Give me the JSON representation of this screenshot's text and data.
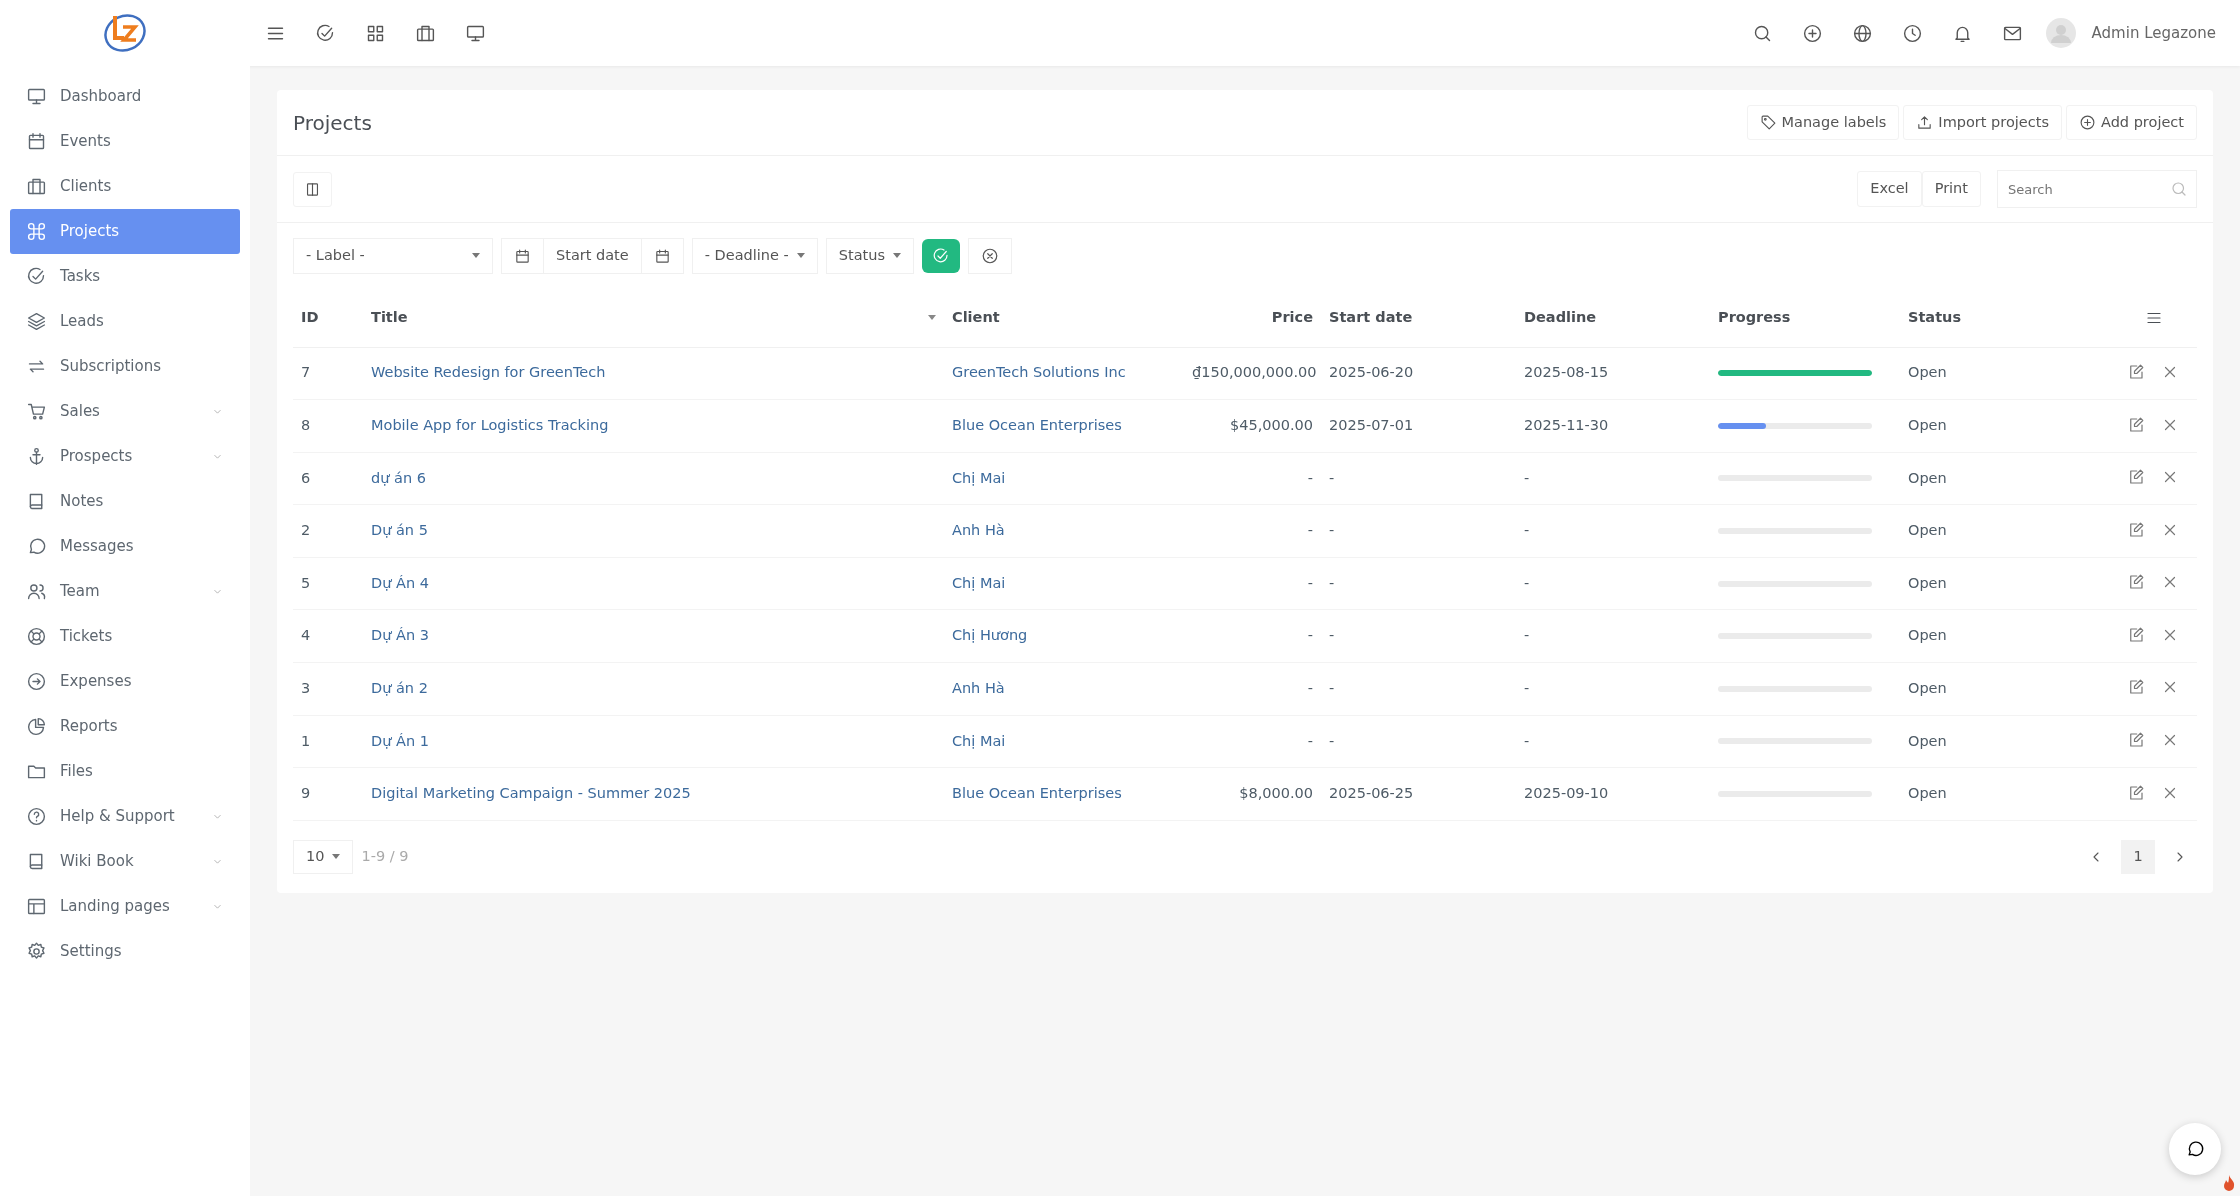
{
  "user": {
    "name": "Admin Legazone"
  },
  "sidebar": {
    "items": [
      {
        "label": "Dashboard",
        "selected": false,
        "has_submenu": false
      },
      {
        "label": "Events",
        "selected": false,
        "has_submenu": false
      },
      {
        "label": "Clients",
        "selected": false,
        "has_submenu": false
      },
      {
        "label": "Projects",
        "selected": true,
        "has_submenu": false
      },
      {
        "label": "Tasks",
        "selected": false,
        "has_submenu": false
      },
      {
        "label": "Leads",
        "selected": false,
        "has_submenu": false
      },
      {
        "label": "Subscriptions",
        "selected": false,
        "has_submenu": false
      },
      {
        "label": "Sales",
        "selected": false,
        "has_submenu": true
      },
      {
        "label": "Prospects",
        "selected": false,
        "has_submenu": true
      },
      {
        "label": "Notes",
        "selected": false,
        "has_submenu": false
      },
      {
        "label": "Messages",
        "selected": false,
        "has_submenu": false
      },
      {
        "label": "Team",
        "selected": false,
        "has_submenu": true
      },
      {
        "label": "Tickets",
        "selected": false,
        "has_submenu": false
      },
      {
        "label": "Expenses",
        "selected": false,
        "has_submenu": false
      },
      {
        "label": "Reports",
        "selected": false,
        "has_submenu": false
      },
      {
        "label": "Files",
        "selected": false,
        "has_submenu": false
      },
      {
        "label": "Help & Support",
        "selected": false,
        "has_submenu": true
      },
      {
        "label": "Wiki Book",
        "selected": false,
        "has_submenu": true
      },
      {
        "label": "Landing pages",
        "selected": false,
        "has_submenu": true
      },
      {
        "label": "Settings",
        "selected": false,
        "has_submenu": false
      }
    ]
  },
  "page": {
    "title": "Projects",
    "actions": [
      {
        "label": "Manage labels"
      },
      {
        "label": "Import projects"
      },
      {
        "label": "Add project"
      }
    ]
  },
  "toolbar": {
    "export_buttons": [
      "Excel",
      "Print"
    ],
    "search": {
      "placeholder": "Search"
    }
  },
  "filters": {
    "label_select": "- Label -",
    "start_date": "Start date",
    "deadline": "- Deadline -",
    "status": "Status"
  },
  "table": {
    "columns": [
      "ID",
      "Title",
      "Client",
      "Price",
      "Start date",
      "Deadline",
      "Progress",
      "Status"
    ],
    "rows": [
      {
        "id": "7",
        "title": "Website Redesign for GreenTech",
        "client": "GreenTech Solutions Inc",
        "price": "₫150,000,000.00",
        "start_date": "2025-06-20",
        "deadline": "2025-08-15",
        "progress": {
          "level": 1
        },
        "status": "Open"
      },
      {
        "id": "8",
        "title": "Mobile App for Logistics Tracking",
        "client": "Blue Ocean Enterprises",
        "price": "$45,000.00",
        "start_date": "2025-07-01",
        "deadline": "2025-11-30",
        "progress": {
          "level": 0.31
        },
        "status": "Open"
      },
      {
        "id": "6",
        "title": "dự án 6",
        "client": "Chị Mai",
        "price": "-",
        "start_date": "-",
        "deadline": "-",
        "progress": {
          "level": 0
        },
        "status": "Open"
      },
      {
        "id": "2",
        "title": "Dự án 5",
        "client": "Anh Hà",
        "price": "-",
        "start_date": "-",
        "deadline": "-",
        "progress": {
          "level": 0
        },
        "status": "Open"
      },
      {
        "id": "5",
        "title": "Dự Án 4",
        "client": "Chị Mai",
        "price": "-",
        "start_date": "-",
        "deadline": "-",
        "progress": {
          "level": 0
        },
        "status": "Open"
      },
      {
        "id": "4",
        "title": "Dự Án 3",
        "client": "Chị Hương",
        "price": "-",
        "start_date": "-",
        "deadline": "-",
        "progress": {
          "level": 0
        },
        "status": "Open"
      },
      {
        "id": "3",
        "title": "Dự án 2",
        "client": "Anh Hà",
        "price": "-",
        "start_date": "-",
        "deadline": "-",
        "progress": {
          "level": 0
        },
        "status": "Open"
      },
      {
        "id": "1",
        "title": "Dự Án 1",
        "client": "Chị Mai",
        "price": "-",
        "start_date": "-",
        "deadline": "-",
        "progress": {
          "level": 0
        },
        "status": "Open"
      },
      {
        "id": "9",
        "title": "Digital Marketing Campaign - Summer 2025",
        "client": "Blue Ocean Enterprises",
        "price": "$8,000.00",
        "start_date": "2025-06-25",
        "deadline": "2025-09-10",
        "progress": {
          "level": 0
        },
        "status": "Open"
      }
    ]
  },
  "pagination": {
    "page_size": "10",
    "range": "1-9 / 9",
    "pages": [
      {
        "label": "1",
        "selected": true
      }
    ]
  }
}
